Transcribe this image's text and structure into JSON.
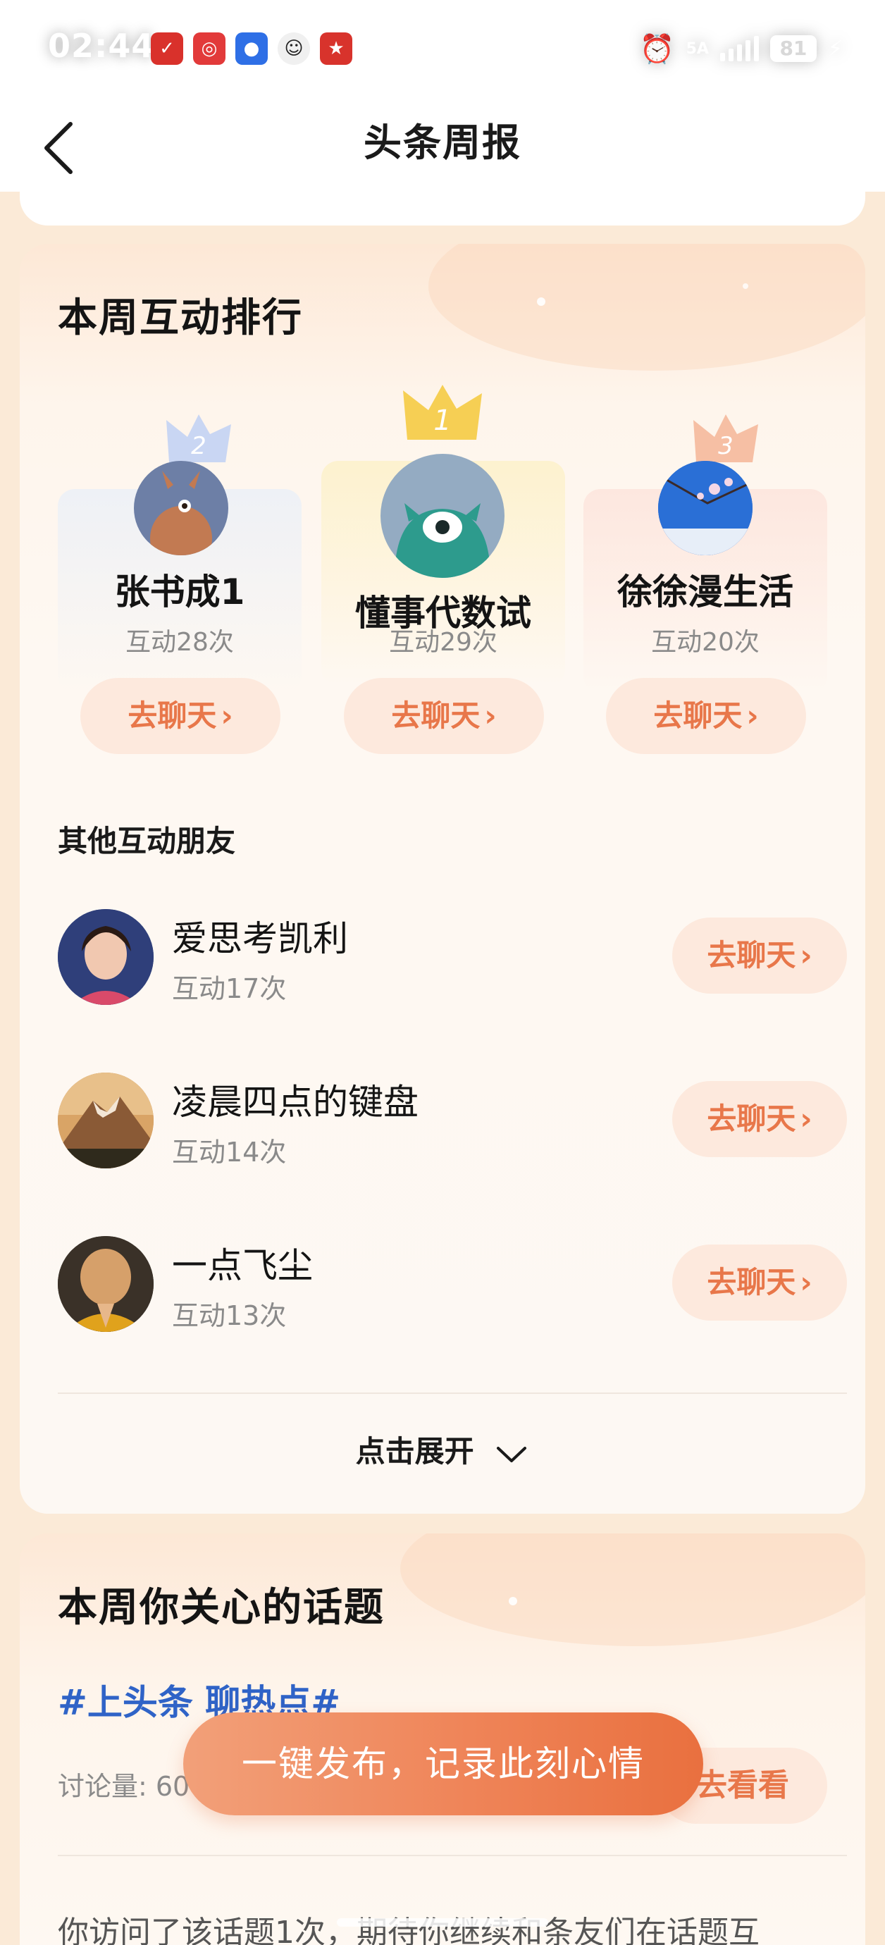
{
  "status_bar": {
    "time": "02:44",
    "battery": "81",
    "network": "5A"
  },
  "header": {
    "title": "头条周报"
  },
  "ranking": {
    "title": "本周互动排行",
    "top": [
      {
        "rank": "2",
        "name": "张书成1",
        "count": "互动28次",
        "button": "去聊天"
      },
      {
        "rank": "1",
        "name": "懂事代数试",
        "count": "互动29次",
        "button": "去聊天"
      },
      {
        "rank": "3",
        "name": "徐徐漫生活",
        "count": "互动20次",
        "button": "去聊天"
      }
    ],
    "others_title": "其他互动朋友",
    "others": [
      {
        "name": "爱思考凯利",
        "count": "互动17次",
        "button": "去聊天"
      },
      {
        "name": "凌晨四点的键盘",
        "count": "互动14次",
        "button": "去聊天"
      },
      {
        "name": "一点飞尘",
        "count": "互动13次",
        "button": "去聊天"
      }
    ],
    "expand_label": "点击展开"
  },
  "topics": {
    "title": "本周你关心的话题",
    "tag": "#上头条 聊热点#",
    "meta": "讨论量: 60",
    "button": "去看看",
    "desc": "你访问了该话题1次，期待你继续和条友们在话题互"
  },
  "publish_button": "一键发布，记录此刻心情",
  "colors": {
    "accent": "#e8774a",
    "topic_blue": "#2f63c7",
    "page_bg": "#fbead7"
  }
}
